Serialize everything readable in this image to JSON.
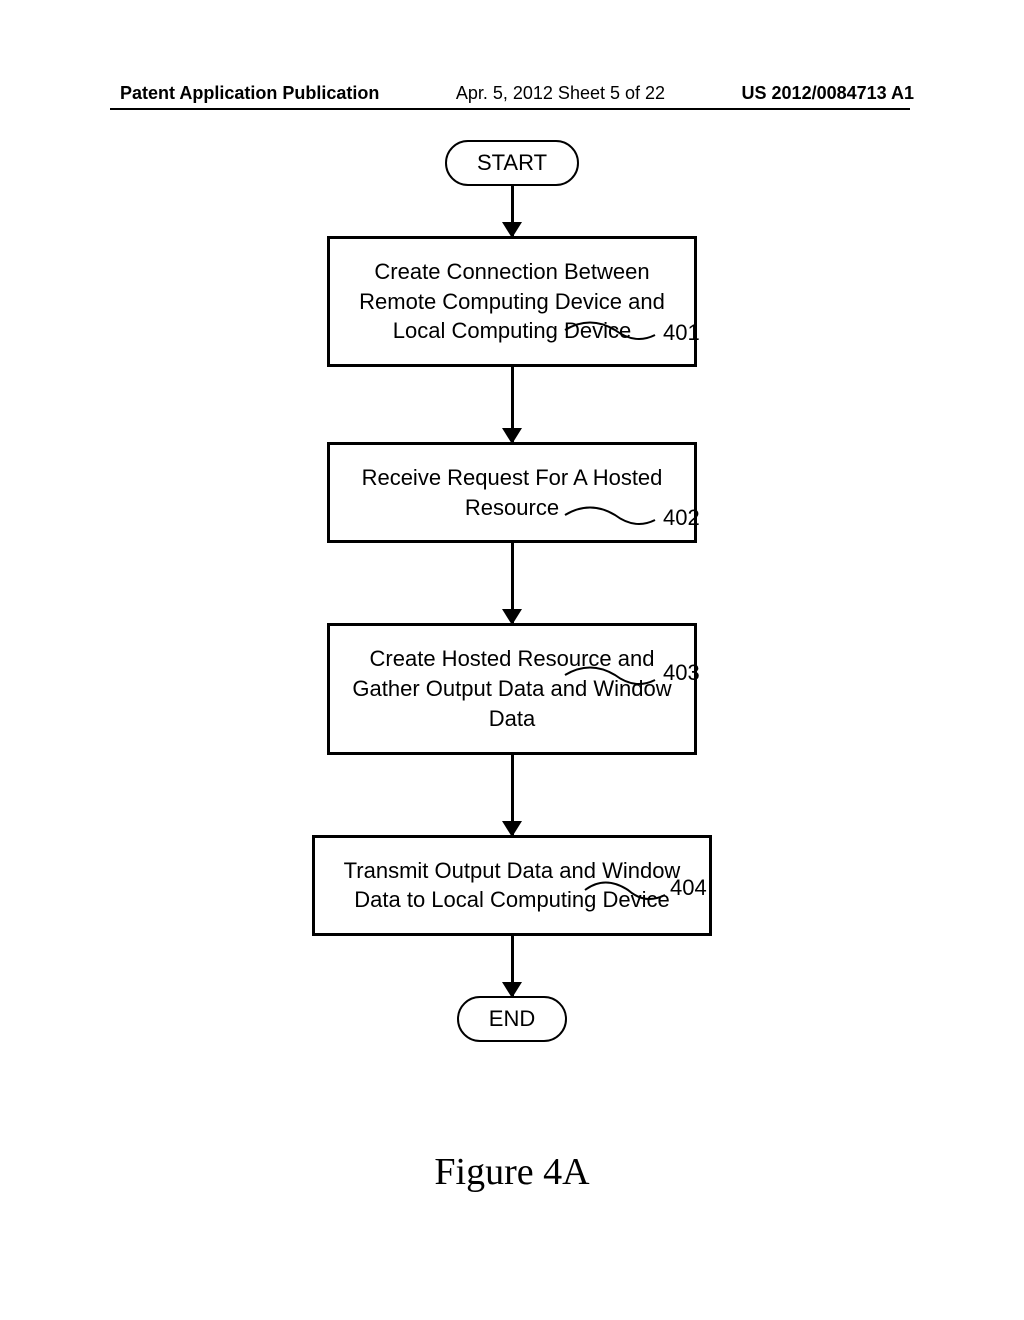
{
  "header": {
    "left": "Patent Application Publication",
    "center": "Apr. 5, 2012   Sheet 5 of 22",
    "right": "US 2012/0084713 A1"
  },
  "flowchart": {
    "start": "START",
    "end": "END",
    "steps": [
      {
        "text": "Create Connection Between Remote Computing Device and Local Computing Device",
        "label": "401"
      },
      {
        "text": "Receive Request For A Hosted Resource",
        "label": "402"
      },
      {
        "text": "Create Hosted Resource and Gather Output Data and Window Data",
        "label": "403"
      },
      {
        "text": "Transmit Output Data and Window Data to Local Computing Device",
        "label": "404"
      }
    ]
  },
  "figure_label": "Figure 4A"
}
